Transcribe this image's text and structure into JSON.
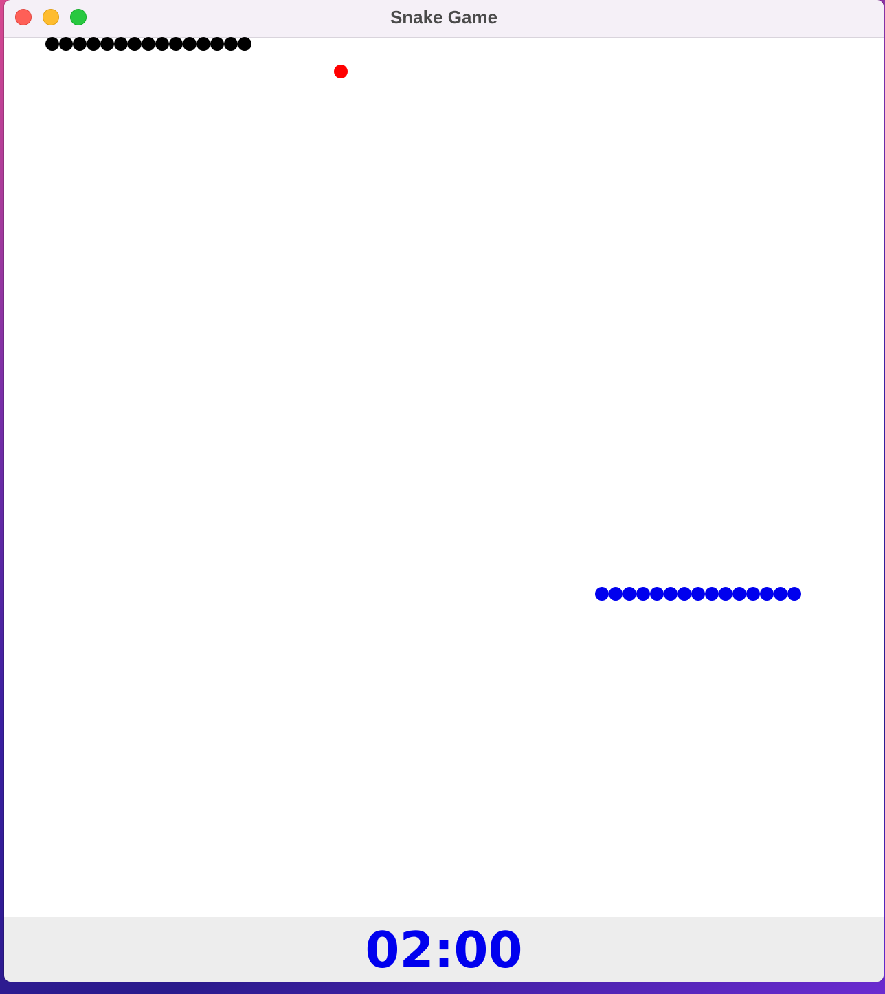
{
  "window": {
    "title": "Snake Game"
  },
  "game": {
    "snake_black": {
      "color": "#000000",
      "segment_count": 15
    },
    "snake_blue": {
      "color": "#0000ee",
      "segment_count": 15
    },
    "food": {
      "color": "#ff0000"
    }
  },
  "footer": {
    "timer": "02:00",
    "timer_color": "#0000ee"
  }
}
